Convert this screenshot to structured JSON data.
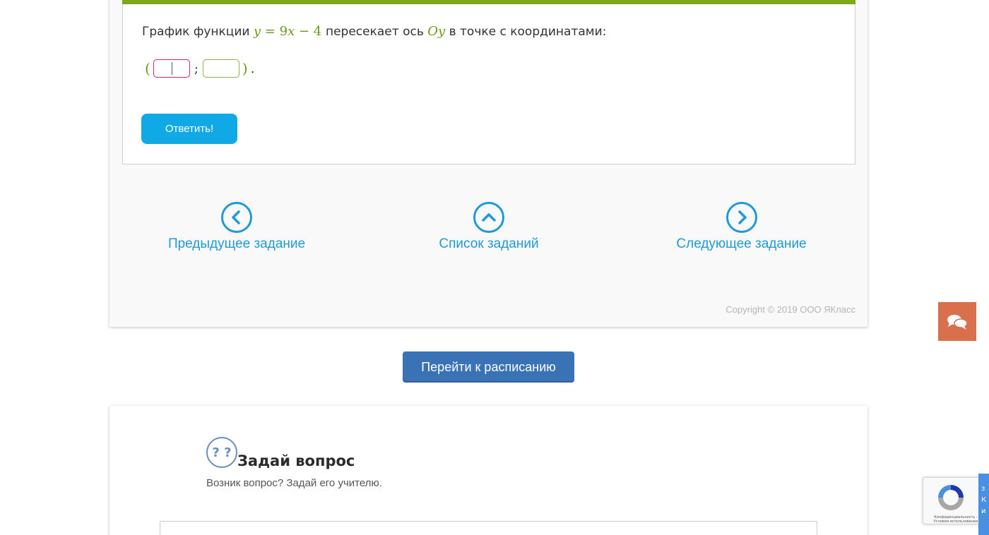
{
  "task": {
    "question_text": "График функции",
    "equation": {
      "y": "y",
      "eq": "=",
      "coef": "9",
      "x": "x",
      "minus": "−",
      "const": "4"
    },
    "question_mid": "пересекает ось",
    "axis_name": "Oy",
    "question_end": "в точке с координатами:",
    "open_paren": "(",
    "separator": ";",
    "close_paren": ")",
    "period": ".",
    "answer_x_value": "",
    "answer_y_value": "",
    "submit_label": "Ответить!"
  },
  "nav": {
    "prev_label": "Предыдущее задание",
    "list_label": "Список заданий",
    "next_label": "Следующее задание"
  },
  "copyright": "Copyright © 2019 ООО ЯКласс",
  "schedule_button": "Перейти к расписанию",
  "ask": {
    "icon_text": "? ?",
    "title": "Задай вопрос",
    "subtitle": "Возник вопрос? Задай его учителю."
  },
  "recaptcha": {
    "text": "Конфиденциальность - Условия использования",
    "side_text": "з\nК\nи"
  },
  "colors": {
    "accent_green": "#7ea819",
    "link_blue": "#1e9bd7",
    "submit_blue": "#11a8e6",
    "schedule_blue": "#3a73b5",
    "chat_orange": "#d8704e"
  }
}
